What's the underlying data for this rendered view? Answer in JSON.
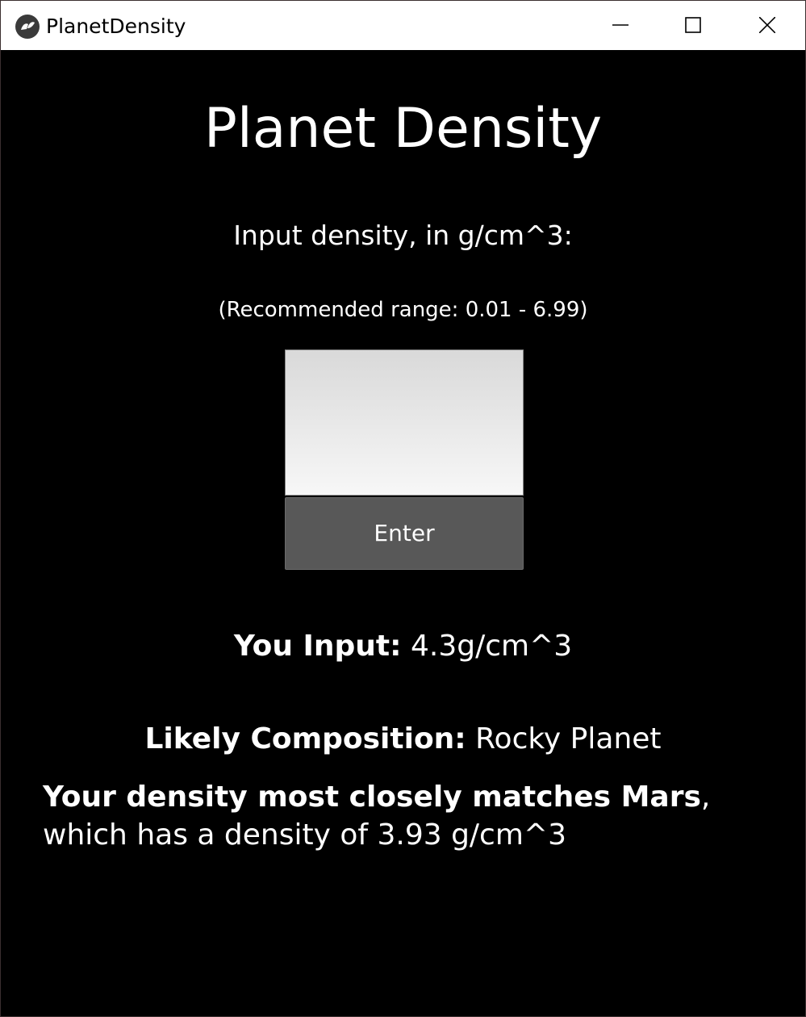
{
  "window": {
    "title": "PlanetDensity"
  },
  "main": {
    "heading": "Planet Density",
    "prompt": "Input density, in g/cm^3:",
    "range_hint": "(Recommended range: 0.01 - 6.99)",
    "input_value": "",
    "enter_label": "Enter",
    "you_input_label": "You Input:",
    "you_input_value": " 4.3g/cm^3",
    "composition_label": "Likely Composition:",
    "composition_value": " Rocky Planet",
    "match_bold": "Your density most closely matches Mars",
    "match_rest": ", which has a density of 3.93 g/cm^3"
  },
  "icons": {
    "app": "kivy-logo-icon",
    "minimize": "minimize-icon",
    "maximize": "maximize-icon",
    "close": "close-icon"
  },
  "colors": {
    "background": "#000000",
    "text": "#ffffff",
    "button": "#585858",
    "titlebar": "#ffffff"
  }
}
